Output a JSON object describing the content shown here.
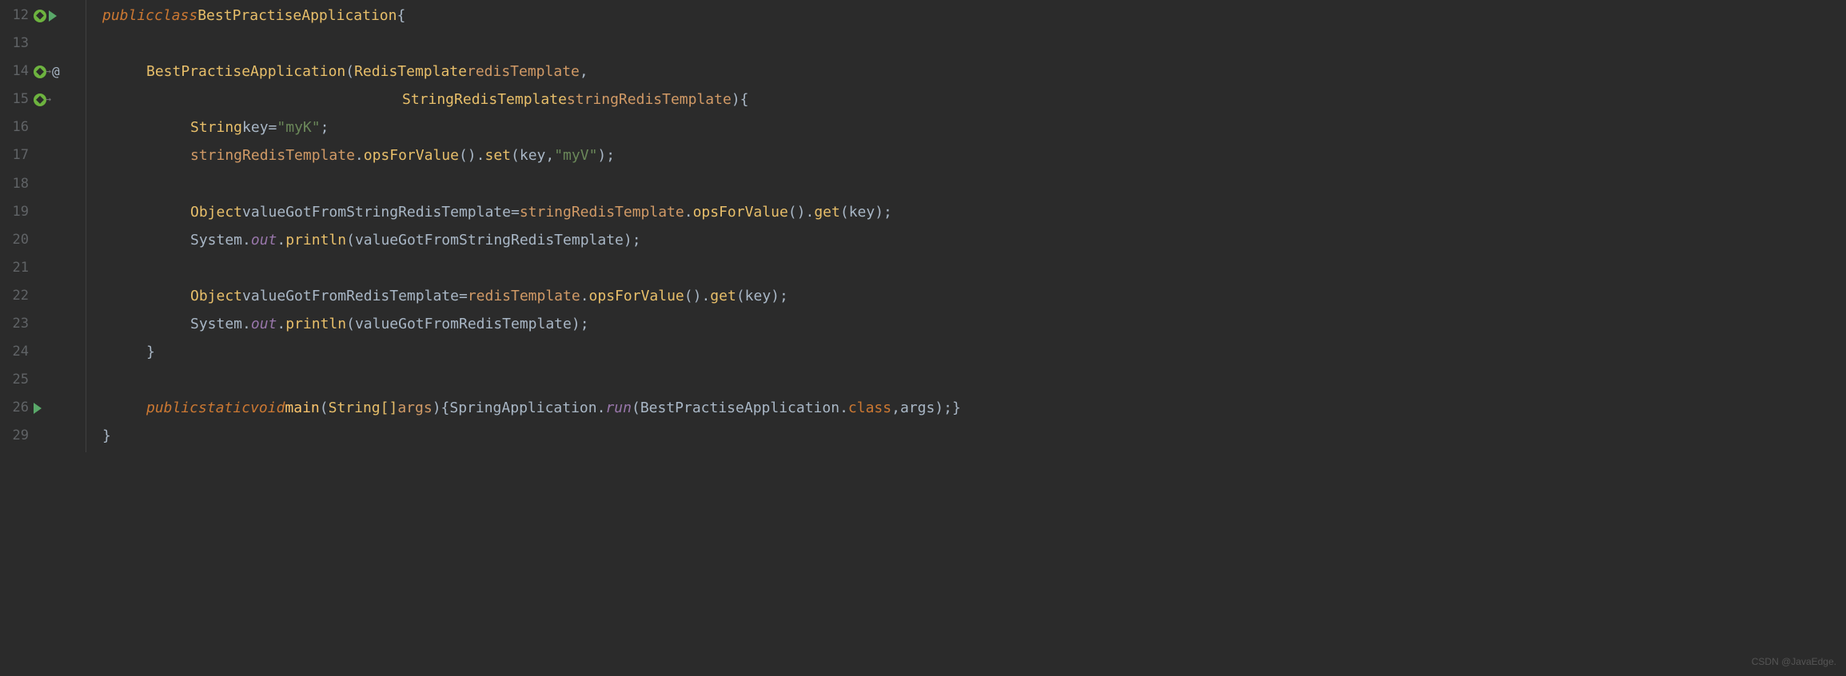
{
  "lines": {
    "12": "12",
    "13": "13",
    "14": "14",
    "15": "15",
    "16": "16",
    "17": "17",
    "18": "18",
    "19": "19",
    "20": "20",
    "21": "21",
    "22": "22",
    "23": "23",
    "24": "24",
    "25": "25",
    "26": "26",
    "29": "29"
  },
  "code": {
    "public": "public",
    "class": "class",
    "static": "static",
    "void": "void",
    "className": "BestPractiseApplication",
    "openBrace": " {",
    "closeBrace": "}",
    "ctorName": "BestPractiseApplication",
    "openParen": "(",
    "closeParen": ")",
    "redisTemplateType": "RedisTemplate",
    "redisTemplateParam": " redisTemplate",
    "comma": ",",
    "stringRedisTemplateType": "StringRedisTemplate",
    "stringRedisTemplateParam": " stringRedisTemplate",
    "stringType": "String",
    "keyVar": " key",
    "eq": " = ",
    "myK": "\"myK\"",
    "semi": ";",
    "stringRedisTemplateVar": "stringRedisTemplate",
    "dot": ".",
    "opsForValue": "opsForValue",
    "emptyParens": "()",
    "set": "set",
    "keyArg": "key",
    "commaSpace": ", ",
    "myV": "\"myV\"",
    "objectType": "Object",
    "valueGotFromStringRedisTemplate": " valueGotFromStringRedisTemplate",
    "get": "get",
    "systemClass": "System",
    "out": "out",
    "println": "println",
    "valueGotFromStringRedisTemplateArg": "valueGotFromStringRedisTemplate",
    "valueGotFromRedisTemplate": " valueGotFromRedisTemplate",
    "redisTemplateVar": "redisTemplate",
    "valueGotFromRedisTemplateArg": "valueGotFromRedisTemplate",
    "main": "main",
    "stringArray": "String[]",
    "argsParam": " args",
    "springApplication": "SpringApplication",
    "run": "run",
    "classRef": "class",
    "argsArg": "args",
    "space": " "
  },
  "atSymbol": "@",
  "watermark": "CSDN @JavaEdge."
}
